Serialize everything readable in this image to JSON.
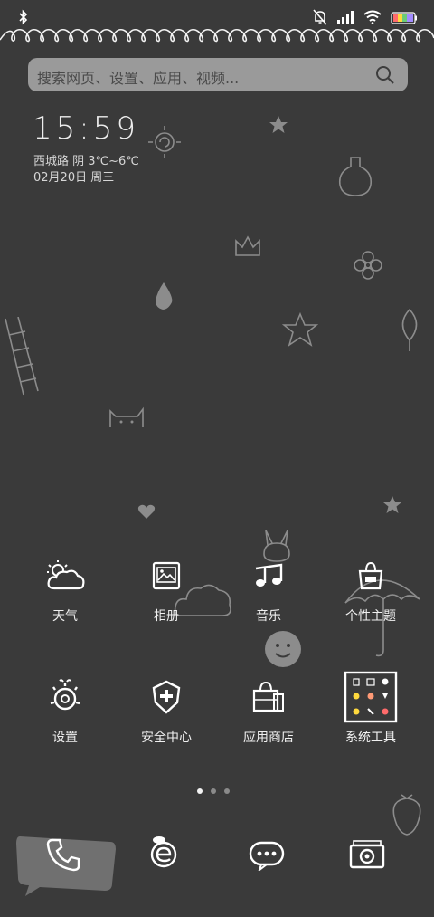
{
  "search": {
    "placeholder": "搜索网页、设置、应用、视频..."
  },
  "widget": {
    "time": "15:59",
    "weather": "西城路  阴  3℃~6℃",
    "date": "02月20日 周三"
  },
  "apps": [
    {
      "label": "天气",
      "icon": "weather-icon"
    },
    {
      "label": "相册",
      "icon": "gallery-icon"
    },
    {
      "label": "音乐",
      "icon": "music-icon"
    },
    {
      "label": "个性主题",
      "icon": "theme-icon"
    },
    {
      "label": "设置",
      "icon": "settings-icon"
    },
    {
      "label": "安全中心",
      "icon": "security-icon"
    },
    {
      "label": "应用商店",
      "icon": "app-store-icon"
    },
    {
      "label": "系统工具",
      "icon": "system-tools-folder"
    }
  ],
  "dock": [
    {
      "icon": "phone-icon"
    },
    {
      "icon": "browser-icon"
    },
    {
      "icon": "messages-icon"
    },
    {
      "icon": "camera-icon"
    }
  ],
  "pager": {
    "pages": 3,
    "current": 1
  },
  "colors": {
    "background": "#3a3a3a",
    "search_bg": "#9a9a9a",
    "icon_line": "#ffffff"
  }
}
